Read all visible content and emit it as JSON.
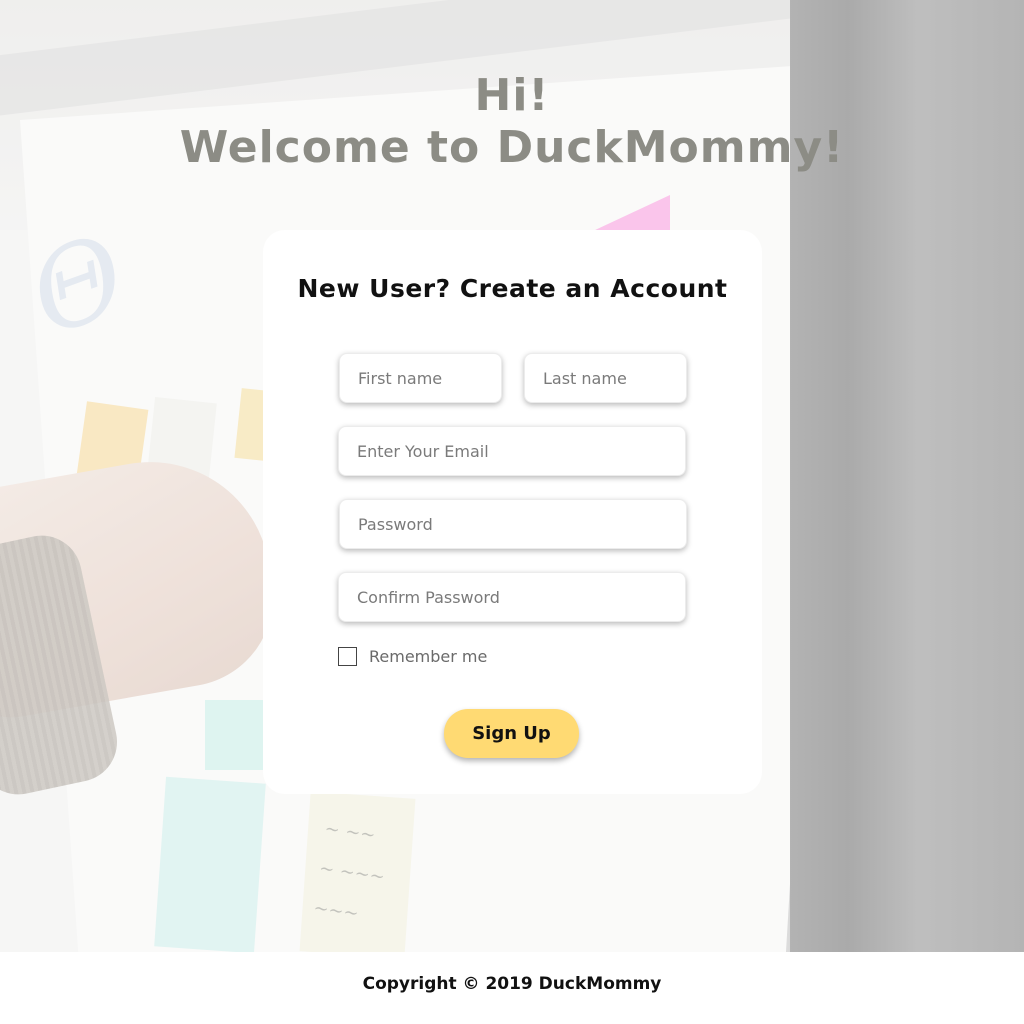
{
  "hero": {
    "line1": "Hi!",
    "line2": "Welcome to DuckMommy!"
  },
  "form": {
    "title": "New User? Create an Account",
    "first_name_placeholder": "First name",
    "last_name_placeholder": "Last name",
    "email_placeholder": "Enter Your Email",
    "password_placeholder": "Password",
    "confirm_password_placeholder": "Confirm Password",
    "remember_label": "Remember me",
    "remember_checked": false,
    "submit_label": "Sign Up"
  },
  "footer": {
    "copyright": "Copyright © 2019 DuckMommy"
  },
  "colors": {
    "button": "#ffda73",
    "heading": "#8c8c85",
    "card": "#ffffff"
  }
}
